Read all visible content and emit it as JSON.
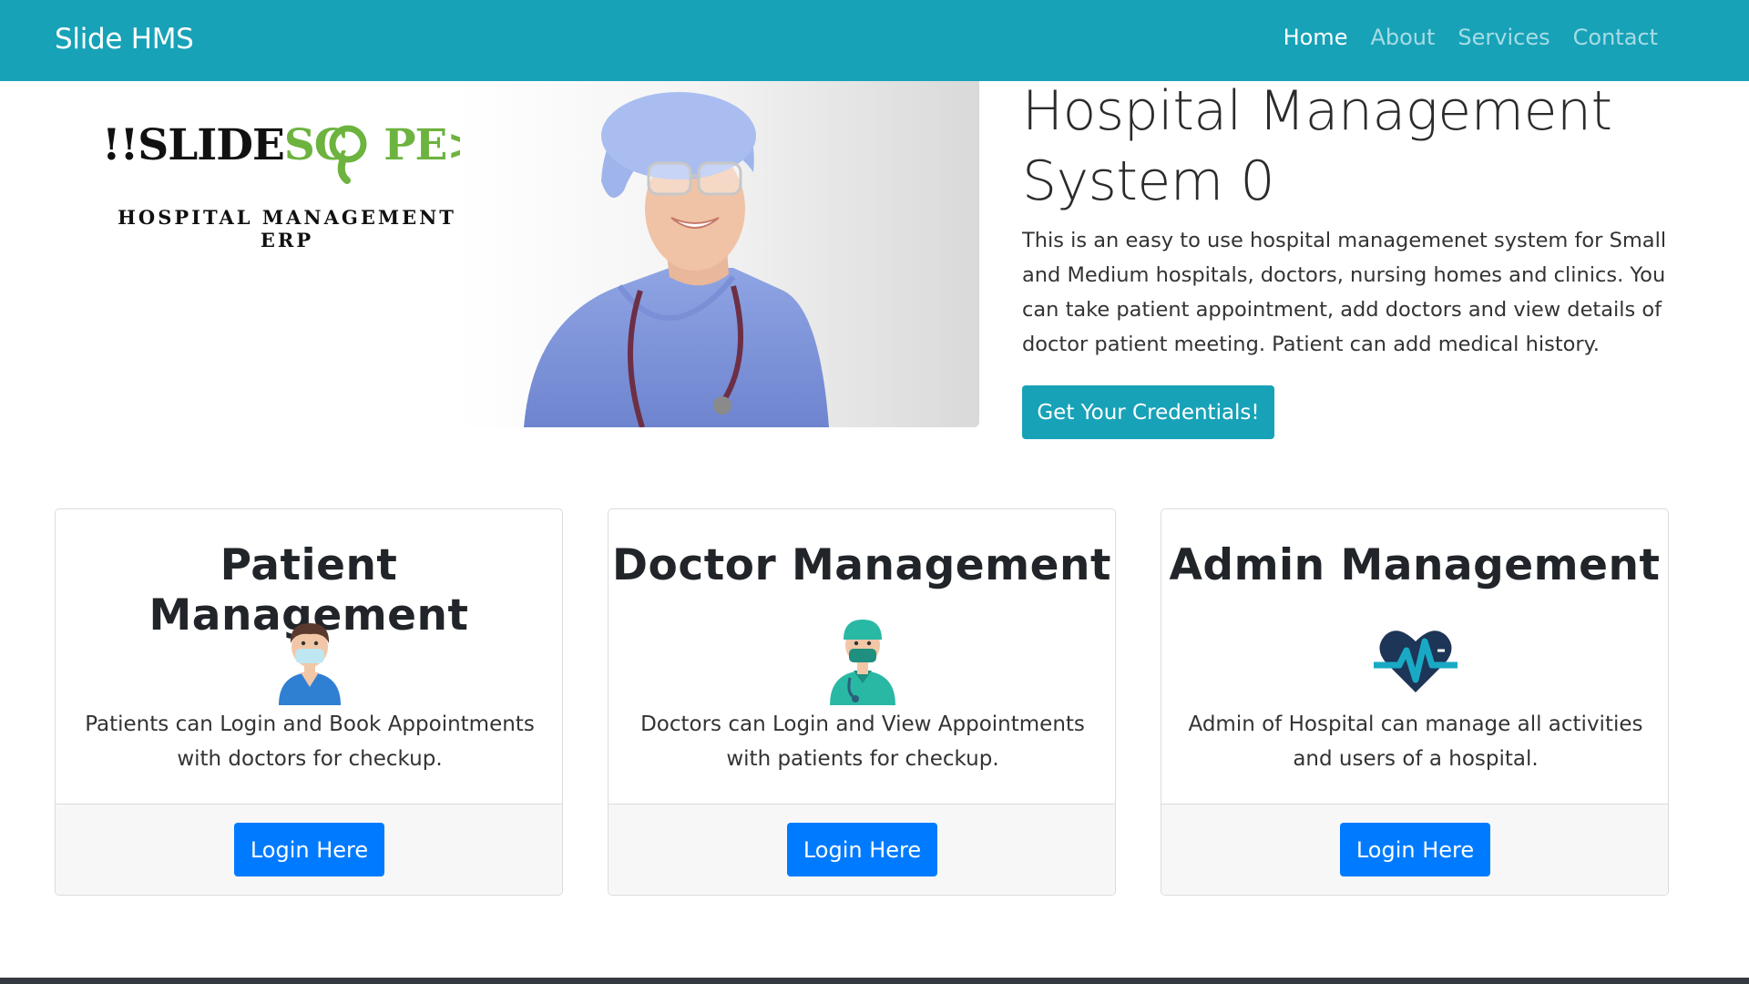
{
  "navbar": {
    "brand": "Slide HMS",
    "links": [
      {
        "label": "Home",
        "active": true
      },
      {
        "label": "About",
        "active": false
      },
      {
        "label": "Services",
        "active": false
      },
      {
        "label": "Contact",
        "active": false
      }
    ],
    "bg_color": "#17a2b8"
  },
  "logo": {
    "word_dark": "!!SLIDE",
    "word_green_1": "SC",
    "word_green_2": "PE>>",
    "subtitle_line1": "HOSPITAL MANAGEMENT",
    "subtitle_line2": "ERP",
    "green_color": "#6db33f"
  },
  "hero": {
    "image": "nurse-photo",
    "title_line1": "Hospital Management",
    "title_line2": "System 0",
    "description": "This is an easy to use hospital managemenet system for Small and Medium hospitals, doctors, nursing homes and clinics. You can take patient appointment, add doctors and view details of doctor patient meeting. Patient can add medical history.",
    "cta_label": "Get Your Credentials!"
  },
  "cards": [
    {
      "title": "Patient Management",
      "icon": "patient-icon",
      "text": "Patients can Login and Book Appointments with doctors for checkup.",
      "button": "Login Here"
    },
    {
      "title": "Doctor Management",
      "icon": "doctor-icon",
      "text": "Doctors can Login and View Appointments with patients for checkup.",
      "button": "Login Here"
    },
    {
      "title": "Admin Management",
      "icon": "heartbeat-icon",
      "text": "Admin of Hospital can manage all activities and users of a hospital.",
      "button": "Login Here"
    }
  ],
  "colors": {
    "primary": "#007bff",
    "info": "#17a2b8",
    "icon_navy": "#1d3557",
    "icon_teal": "#1aa9c4"
  }
}
